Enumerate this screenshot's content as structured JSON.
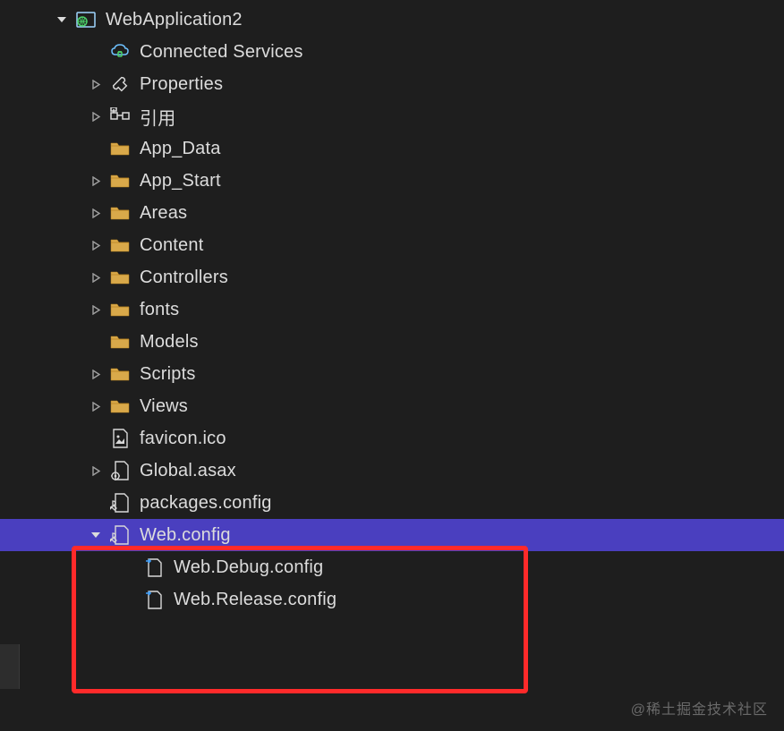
{
  "project": {
    "name": "WebApplication2"
  },
  "tree": {
    "items": [
      {
        "label": "Connected Services",
        "icon": "cloud-plug",
        "indent": 2,
        "expander": "none"
      },
      {
        "label": "Properties",
        "icon": "wrench",
        "indent": 2,
        "expander": "collapsed"
      },
      {
        "label": "引用",
        "icon": "references",
        "indent": 2,
        "expander": "collapsed"
      },
      {
        "label": "App_Data",
        "icon": "folder",
        "indent": 2,
        "expander": "none"
      },
      {
        "label": "App_Start",
        "icon": "folder",
        "indent": 2,
        "expander": "collapsed"
      },
      {
        "label": "Areas",
        "icon": "folder",
        "indent": 2,
        "expander": "collapsed"
      },
      {
        "label": "Content",
        "icon": "folder",
        "indent": 2,
        "expander": "collapsed"
      },
      {
        "label": "Controllers",
        "icon": "folder",
        "indent": 2,
        "expander": "collapsed"
      },
      {
        "label": "fonts",
        "icon": "folder",
        "indent": 2,
        "expander": "collapsed"
      },
      {
        "label": "Models",
        "icon": "folder",
        "indent": 2,
        "expander": "none"
      },
      {
        "label": "Scripts",
        "icon": "folder",
        "indent": 2,
        "expander": "collapsed"
      },
      {
        "label": "Views",
        "icon": "folder",
        "indent": 2,
        "expander": "collapsed"
      },
      {
        "label": "favicon.ico",
        "icon": "image-file",
        "indent": 2,
        "expander": "none"
      },
      {
        "label": "Global.asax",
        "icon": "gear-file",
        "indent": 2,
        "expander": "collapsed"
      },
      {
        "label": "packages.config",
        "icon": "wrench-file",
        "indent": 2,
        "expander": "none"
      },
      {
        "label": "Web.config",
        "icon": "wrench-file",
        "indent": 2,
        "expander": "expanded",
        "selected": true
      },
      {
        "label": "Web.Debug.config",
        "icon": "transform-file",
        "indent": 3,
        "expander": "none"
      },
      {
        "label": "Web.Release.config",
        "icon": "transform-file",
        "indent": 3,
        "expander": "none"
      }
    ]
  },
  "watermark": "@稀土掘金技术社区"
}
